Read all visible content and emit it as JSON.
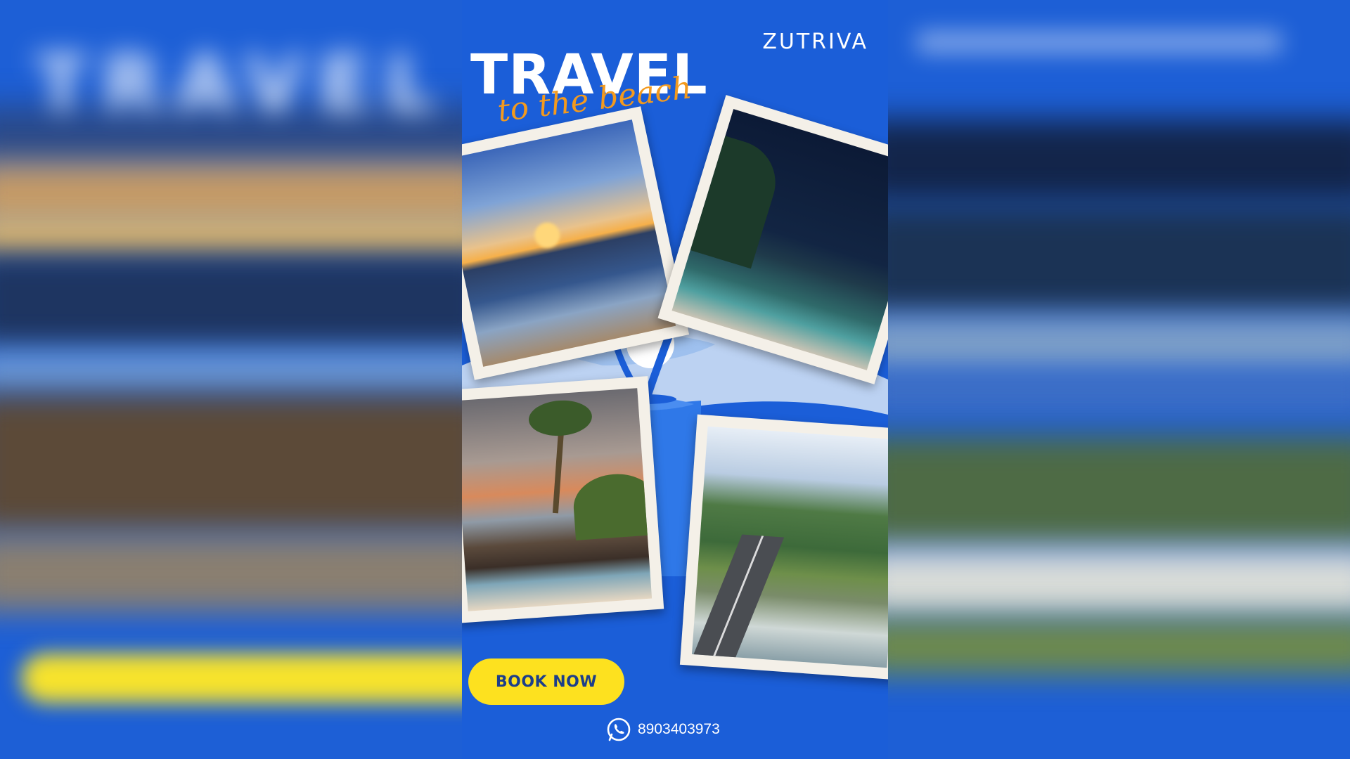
{
  "brand": {
    "logo": "ZUTRIVA"
  },
  "poster": {
    "title": "TRAVEL",
    "subtitle": "to the beach",
    "cta_label": "BOOK NOW",
    "phone": "8903403973",
    "contact_icon": "whatsapp-icon"
  },
  "colors": {
    "background": "#1b5ed8",
    "title": "#ffffff",
    "subtitle": "#f39a1e",
    "cta_background": "#fde11f",
    "cta_text": "#1d3e8a",
    "photo_frame": "#f4f0e8"
  },
  "photos": [
    {
      "subject": "sunset over ocean waves"
    },
    {
      "subject": "beach at dusk with forested hill"
    },
    {
      "subject": "palm tree on rocky shore"
    },
    {
      "subject": "coastal road along green cliffs"
    }
  ],
  "decorations": [
    "palm-trees-icon",
    "sun-icon",
    "island-icon"
  ]
}
